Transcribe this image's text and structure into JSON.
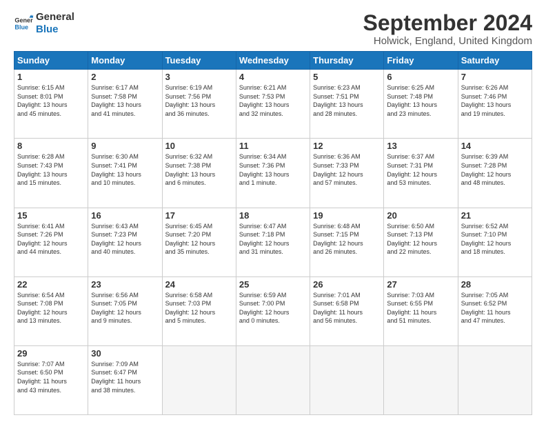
{
  "logo": {
    "line1": "General",
    "line2": "Blue"
  },
  "title": "September 2024",
  "location": "Holwick, England, United Kingdom",
  "days_of_week": [
    "Sunday",
    "Monday",
    "Tuesday",
    "Wednesday",
    "Thursday",
    "Friday",
    "Saturday"
  ],
  "weeks": [
    [
      {
        "day": 1,
        "lines": [
          "Sunrise: 6:15 AM",
          "Sunset: 8:01 PM",
          "Daylight: 13 hours",
          "and 45 minutes."
        ]
      },
      {
        "day": 2,
        "lines": [
          "Sunrise: 6:17 AM",
          "Sunset: 7:58 PM",
          "Daylight: 13 hours",
          "and 41 minutes."
        ]
      },
      {
        "day": 3,
        "lines": [
          "Sunrise: 6:19 AM",
          "Sunset: 7:56 PM",
          "Daylight: 13 hours",
          "and 36 minutes."
        ]
      },
      {
        "day": 4,
        "lines": [
          "Sunrise: 6:21 AM",
          "Sunset: 7:53 PM",
          "Daylight: 13 hours",
          "and 32 minutes."
        ]
      },
      {
        "day": 5,
        "lines": [
          "Sunrise: 6:23 AM",
          "Sunset: 7:51 PM",
          "Daylight: 13 hours",
          "and 28 minutes."
        ]
      },
      {
        "day": 6,
        "lines": [
          "Sunrise: 6:25 AM",
          "Sunset: 7:48 PM",
          "Daylight: 13 hours",
          "and 23 minutes."
        ]
      },
      {
        "day": 7,
        "lines": [
          "Sunrise: 6:26 AM",
          "Sunset: 7:46 PM",
          "Daylight: 13 hours",
          "and 19 minutes."
        ]
      }
    ],
    [
      {
        "day": 8,
        "lines": [
          "Sunrise: 6:28 AM",
          "Sunset: 7:43 PM",
          "Daylight: 13 hours",
          "and 15 minutes."
        ]
      },
      {
        "day": 9,
        "lines": [
          "Sunrise: 6:30 AM",
          "Sunset: 7:41 PM",
          "Daylight: 13 hours",
          "and 10 minutes."
        ]
      },
      {
        "day": 10,
        "lines": [
          "Sunrise: 6:32 AM",
          "Sunset: 7:38 PM",
          "Daylight: 13 hours",
          "and 6 minutes."
        ]
      },
      {
        "day": 11,
        "lines": [
          "Sunrise: 6:34 AM",
          "Sunset: 7:36 PM",
          "Daylight: 13 hours",
          "and 1 minute."
        ]
      },
      {
        "day": 12,
        "lines": [
          "Sunrise: 6:36 AM",
          "Sunset: 7:33 PM",
          "Daylight: 12 hours",
          "and 57 minutes."
        ]
      },
      {
        "day": 13,
        "lines": [
          "Sunrise: 6:37 AM",
          "Sunset: 7:31 PM",
          "Daylight: 12 hours",
          "and 53 minutes."
        ]
      },
      {
        "day": 14,
        "lines": [
          "Sunrise: 6:39 AM",
          "Sunset: 7:28 PM",
          "Daylight: 12 hours",
          "and 48 minutes."
        ]
      }
    ],
    [
      {
        "day": 15,
        "lines": [
          "Sunrise: 6:41 AM",
          "Sunset: 7:26 PM",
          "Daylight: 12 hours",
          "and 44 minutes."
        ]
      },
      {
        "day": 16,
        "lines": [
          "Sunrise: 6:43 AM",
          "Sunset: 7:23 PM",
          "Daylight: 12 hours",
          "and 40 minutes."
        ]
      },
      {
        "day": 17,
        "lines": [
          "Sunrise: 6:45 AM",
          "Sunset: 7:20 PM",
          "Daylight: 12 hours",
          "and 35 minutes."
        ]
      },
      {
        "day": 18,
        "lines": [
          "Sunrise: 6:47 AM",
          "Sunset: 7:18 PM",
          "Daylight: 12 hours",
          "and 31 minutes."
        ]
      },
      {
        "day": 19,
        "lines": [
          "Sunrise: 6:48 AM",
          "Sunset: 7:15 PM",
          "Daylight: 12 hours",
          "and 26 minutes."
        ]
      },
      {
        "day": 20,
        "lines": [
          "Sunrise: 6:50 AM",
          "Sunset: 7:13 PM",
          "Daylight: 12 hours",
          "and 22 minutes."
        ]
      },
      {
        "day": 21,
        "lines": [
          "Sunrise: 6:52 AM",
          "Sunset: 7:10 PM",
          "Daylight: 12 hours",
          "and 18 minutes."
        ]
      }
    ],
    [
      {
        "day": 22,
        "lines": [
          "Sunrise: 6:54 AM",
          "Sunset: 7:08 PM",
          "Daylight: 12 hours",
          "and 13 minutes."
        ]
      },
      {
        "day": 23,
        "lines": [
          "Sunrise: 6:56 AM",
          "Sunset: 7:05 PM",
          "Daylight: 12 hours",
          "and 9 minutes."
        ]
      },
      {
        "day": 24,
        "lines": [
          "Sunrise: 6:58 AM",
          "Sunset: 7:03 PM",
          "Daylight: 12 hours",
          "and 5 minutes."
        ]
      },
      {
        "day": 25,
        "lines": [
          "Sunrise: 6:59 AM",
          "Sunset: 7:00 PM",
          "Daylight: 12 hours",
          "and 0 minutes."
        ]
      },
      {
        "day": 26,
        "lines": [
          "Sunrise: 7:01 AM",
          "Sunset: 6:58 PM",
          "Daylight: 11 hours",
          "and 56 minutes."
        ]
      },
      {
        "day": 27,
        "lines": [
          "Sunrise: 7:03 AM",
          "Sunset: 6:55 PM",
          "Daylight: 11 hours",
          "and 51 minutes."
        ]
      },
      {
        "day": 28,
        "lines": [
          "Sunrise: 7:05 AM",
          "Sunset: 6:52 PM",
          "Daylight: 11 hours",
          "and 47 minutes."
        ]
      }
    ],
    [
      {
        "day": 29,
        "lines": [
          "Sunrise: 7:07 AM",
          "Sunset: 6:50 PM",
          "Daylight: 11 hours",
          "and 43 minutes."
        ]
      },
      {
        "day": 30,
        "lines": [
          "Sunrise: 7:09 AM",
          "Sunset: 6:47 PM",
          "Daylight: 11 hours",
          "and 38 minutes."
        ]
      },
      null,
      null,
      null,
      null,
      null
    ]
  ]
}
